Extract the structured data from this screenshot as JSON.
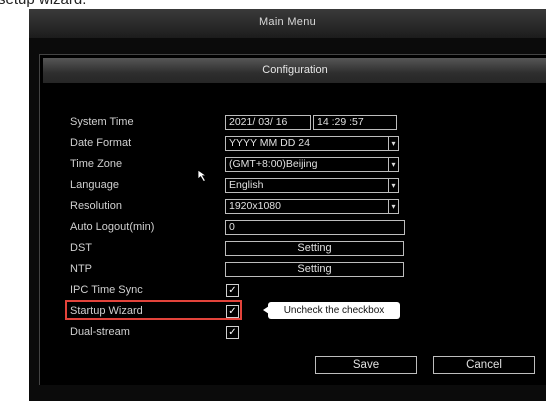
{
  "caption": "setup wizard.",
  "main_menu": {
    "title": "Main Menu"
  },
  "configuration": {
    "title": "Configuration",
    "system_time": {
      "label": "System Time",
      "date": "2021/ 03/ 16",
      "time": "14 :29 :57"
    },
    "date_format": {
      "label": "Date Format",
      "value": "YYYY MM DD 24"
    },
    "time_zone": {
      "label": "Time Zone",
      "value": "(GMT+8:00)Beijing"
    },
    "language": {
      "label": "Language",
      "value": "English"
    },
    "resolution": {
      "label": "Resolution",
      "value": "1920x1080"
    },
    "auto_logout": {
      "label": "Auto Logout(min)",
      "value": "0"
    },
    "dst": {
      "label": "DST",
      "button": "Setting"
    },
    "ntp": {
      "label": "NTP",
      "button": "Setting"
    },
    "ipc_time_sync": {
      "label": "IPC Time Sync",
      "checked": true
    },
    "startup_wizard": {
      "label": "Startup Wizard",
      "checked": true
    },
    "dual_stream": {
      "label": "Dual-stream",
      "checked": true
    },
    "save_label": "Save",
    "cancel_label": "Cancel",
    "dropdown_arrow": "▾",
    "check_mark": "✓"
  },
  "annotation": {
    "callout_text": "Uncheck the checkbox",
    "highlight_color": "#e2433b"
  },
  "icons": {
    "cursor": "cursor-arrow-icon",
    "dropdown": "chevron-down-icon",
    "check": "checkmark-icon"
  }
}
